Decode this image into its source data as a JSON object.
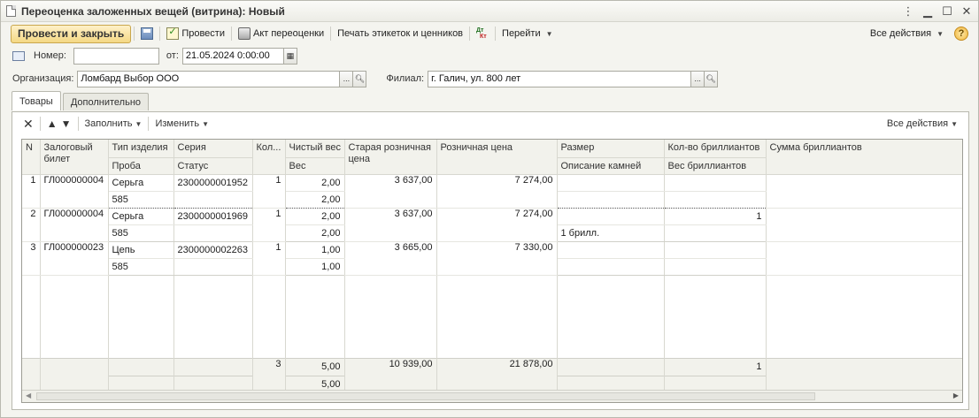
{
  "window": {
    "title": "Переоценка заложенных вещей (витрина): Новый"
  },
  "toolbar": {
    "post_close": "Провести и закрыть",
    "post": "Провести",
    "act": "Акт переоценки",
    "print_labels": "Печать этикеток и ценников",
    "goto": "Перейти",
    "all_actions": "Все действия"
  },
  "header": {
    "number_label": "Номер:",
    "number_value": "",
    "date_label": "от:",
    "date_value": "21.05.2024  0:00:00",
    "org_label": "Организация:",
    "org_value": "Ломбард Выбор ООО",
    "branch_label": "Филиал:",
    "branch_value": "г. Галич, ул. 800 лет"
  },
  "tabs": [
    "Товары",
    "Дополнительно"
  ],
  "inner_toolbar": {
    "fill": "Заполнить",
    "change": "Изменить",
    "all_actions": "Все действия"
  },
  "table": {
    "headers_top": [
      "N",
      "Залоговый билет",
      "Тип изделия",
      "Серия",
      "Кол...",
      "Чистый вес",
      "Старая розничная цена",
      "Розничная цена",
      "Размер",
      "Кол-во бриллиантов",
      "Сумма бриллиантов"
    ],
    "headers_bottom": [
      "Проба",
      "Статус",
      "Вес",
      "Описание камней",
      "Вес бриллиантов"
    ],
    "rows": [
      {
        "n": "1",
        "ticket": "ГЛ000000004",
        "type": "Серьга",
        "series": "2300000001952",
        "qty": "1",
        "net_weight": "2,00",
        "old_price": "3 637,00",
        "price": "7 274,00",
        "size": "",
        "diamonds_count": "",
        "diamonds_sum": "",
        "probe": "585",
        "status": "",
        "weight": "2,00",
        "stones": "",
        "diamonds_weight": ""
      },
      {
        "n": "2",
        "ticket": "ГЛ000000004",
        "type": "Серьга",
        "series": "2300000001969",
        "qty": "1",
        "net_weight": "2,00",
        "old_price": "3 637,00",
        "price": "7 274,00",
        "size": "",
        "diamonds_count": "1",
        "diamonds_sum": "",
        "probe": "585",
        "status": "",
        "weight": "2,00",
        "stones": "1 брилл.",
        "diamonds_weight": ""
      },
      {
        "n": "3",
        "ticket": "ГЛ000000023",
        "type": "Цепь",
        "series": "2300000002263",
        "qty": "1",
        "net_weight": "1,00",
        "old_price": "3 665,00",
        "price": "7 330,00",
        "size": "",
        "diamonds_count": "",
        "diamonds_sum": "",
        "probe": "585",
        "status": "",
        "weight": "1,00",
        "stones": "",
        "diamonds_weight": ""
      }
    ],
    "totals": {
      "qty": "3",
      "net_weight": "5,00",
      "old_price": "10 939,00",
      "price": "21 878,00",
      "diamonds_count": "1",
      "weight": "5,00"
    }
  },
  "icons": [
    "doc-icon",
    "save-icon",
    "post-icon",
    "print-icon",
    "dt-kt-icon",
    "help-icon",
    "number-icon",
    "calendar-icon",
    "delete-icon",
    "move-up-icon",
    "move-down-icon",
    "search-icon"
  ]
}
